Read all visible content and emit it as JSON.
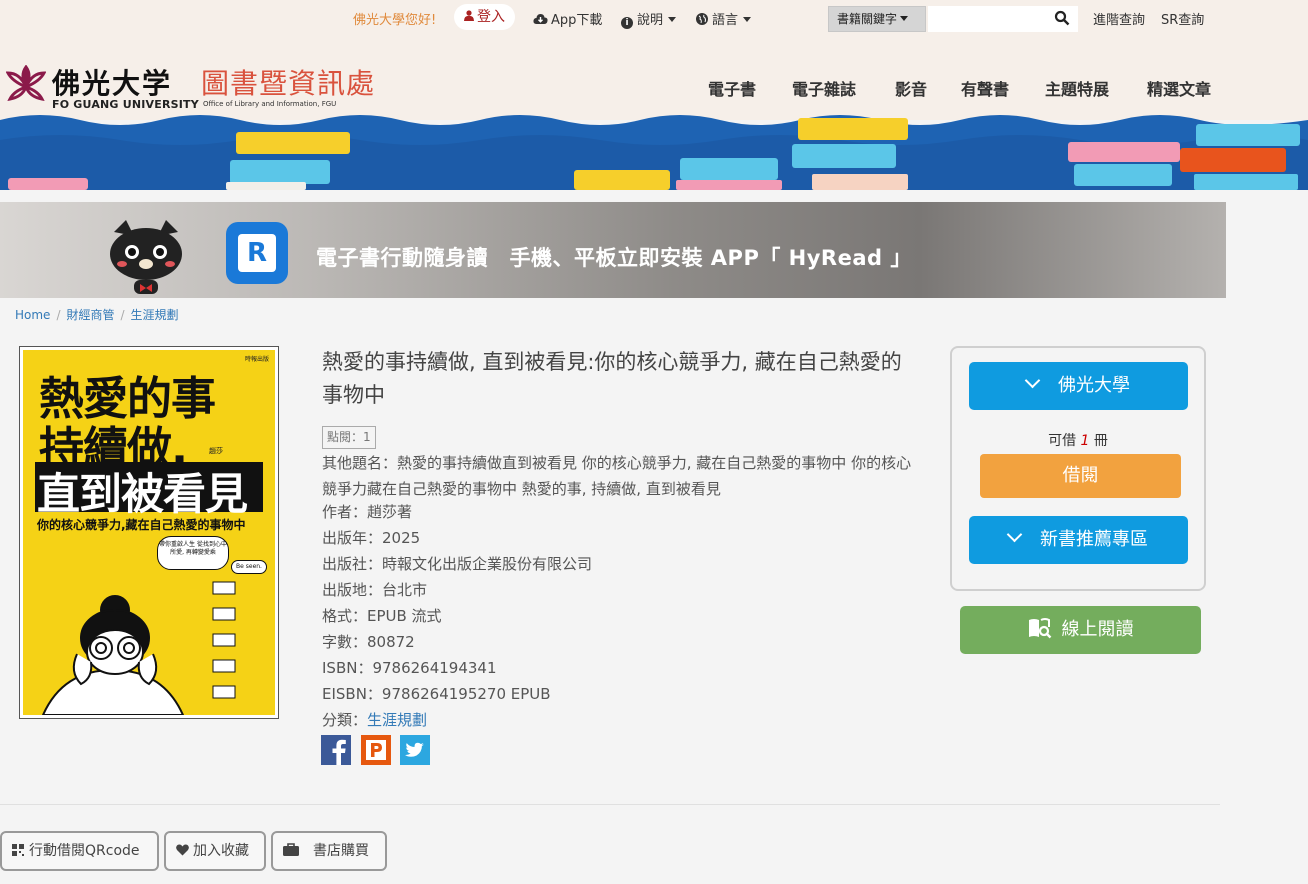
{
  "topbar": {
    "greeting": "佛光大學您好!",
    "login": "登入",
    "app_download": "App下載",
    "help": "說明",
    "language": "語言",
    "search_scope": "書籍關鍵字",
    "search_placeholder": "",
    "advanced_search": "進階查詢",
    "sr_search": "SR查詢"
  },
  "header": {
    "logo_cn": "佛光大学",
    "logo_en": "FO GUANG UNIVERSITY",
    "dept_cn": "圖書暨資訊處",
    "dept_en": "Office of Library and Information, FGU",
    "nav": [
      "電子書",
      "電子雜誌",
      "影音",
      "有聲書",
      "主題特展",
      "精選文章"
    ]
  },
  "promo": {
    "app_letter": "R",
    "text": "電子書行動隨身讀　手機、平板立即安裝 APP「 HyRead 」"
  },
  "breadcrumb": [
    "Home",
    "財經商管",
    "生涯規劃"
  ],
  "cover": {
    "title_line1": "熱愛的事",
    "title_line2": "持續做,",
    "title_line3": "直到被看見",
    "subtitle": "你的核心競爭力,藏在自己熱愛的事物中",
    "author": "趙莎",
    "badge": "Be seen.",
    "bubble": "帶你重啟人生 從找到心中所愛, 再轉變愛乘",
    "publisher_mark": "時報出版"
  },
  "book": {
    "title": "熱愛的事持續做, 直到被看見:你的核心競爭力, 藏在自己熱愛的事物中",
    "hits": "點閱：1",
    "alt_title": "其他題名：熱愛的事持續做直到被看見 你的核心競爭力, 藏在自己熱愛的事物中 你的核心競爭力藏在自己熱愛的事物中 熱愛的事, 持續做, 直到被看見",
    "author": "作者：趙莎著",
    "year": "出版年：2025",
    "publisher": "出版社：時報文化出版企業股份有限公司",
    "place": "出版地：台北市",
    "format": "格式：EPUB 流式",
    "words": "字數：80872",
    "isbn": "ISBN：9786264194341",
    "eisbn": "EISBN：9786264195270 EPUB",
    "category_label": "分類：",
    "category": "生涯規劃"
  },
  "panel": {
    "library_button": "佛光大學",
    "available_prefix": "可借",
    "available_count": "1",
    "available_suffix": "冊",
    "borrow_button": "借閱",
    "new_books_button": "新書推薦專區",
    "read_online_button": "線上閱讀"
  },
  "bottom": {
    "qrcode": "行動借閱QRcode",
    "favorite": "加入收藏",
    "buy": "書店購買"
  },
  "colors": {
    "accent_blue": "#0f9be0",
    "borrow_orange": "#f2a23f",
    "read_green": "#74ad5d",
    "brand_red": "#d9523d",
    "cover_yellow": "#f5d216"
  }
}
